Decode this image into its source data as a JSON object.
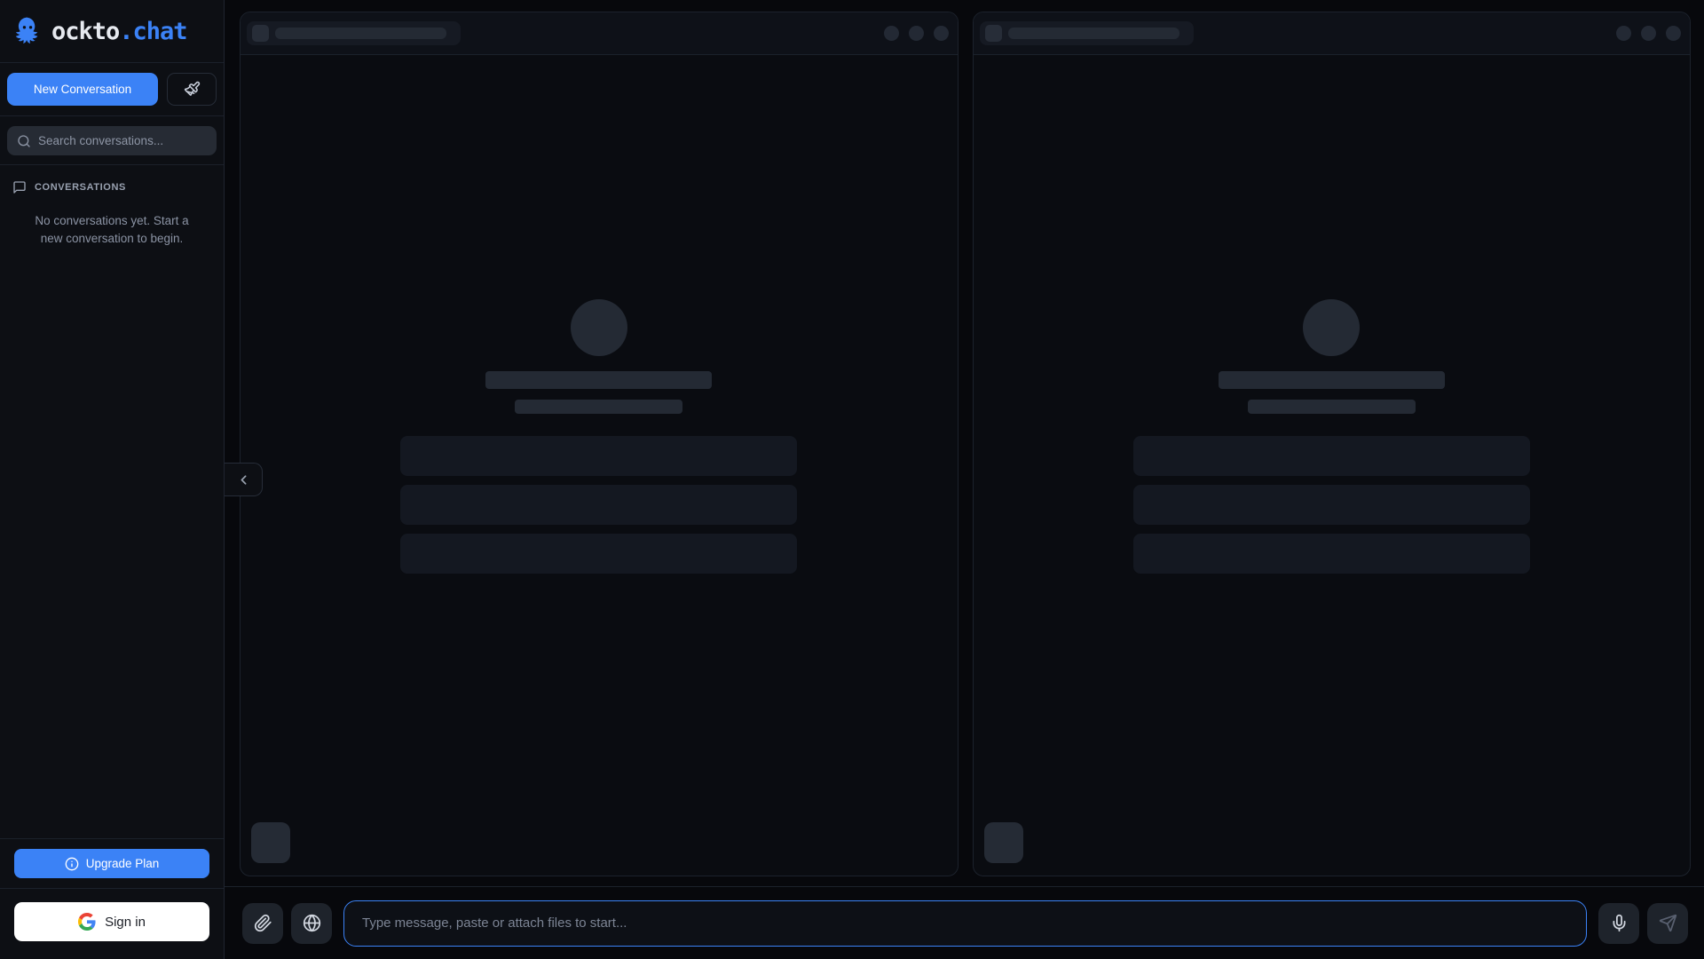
{
  "brand": {
    "title_primary": "ockto",
    "title_accent": ".chat",
    "logo_icon": "octopus-icon"
  },
  "colors": {
    "accent": "#3b82f6",
    "sidebar_bg": "#0d0f14",
    "page_bg": "#07080c"
  },
  "sidebar": {
    "new_conversation_label": "New Conversation",
    "search_placeholder": "Search conversations...",
    "conversations_header": "CONVERSATIONS",
    "empty_state": "No conversations yet. Start a new conversation to begin.",
    "upgrade_label": "Upgrade Plan",
    "sign_in_label": "Sign in"
  },
  "composer": {
    "placeholder": "Type message, paste or attach files to start...",
    "value": ""
  },
  "panels": {
    "count": 2,
    "content": "loading-skeleton",
    "header_action_dots": 3,
    "message_placeholder_bars": 3
  },
  "icons": [
    "octopus-icon",
    "paintbrush-icon",
    "search-icon",
    "message-square-icon",
    "info-icon",
    "google-icon",
    "chevron-left-icon",
    "paperclip-icon",
    "globe-icon",
    "mic-icon",
    "send-icon"
  ]
}
